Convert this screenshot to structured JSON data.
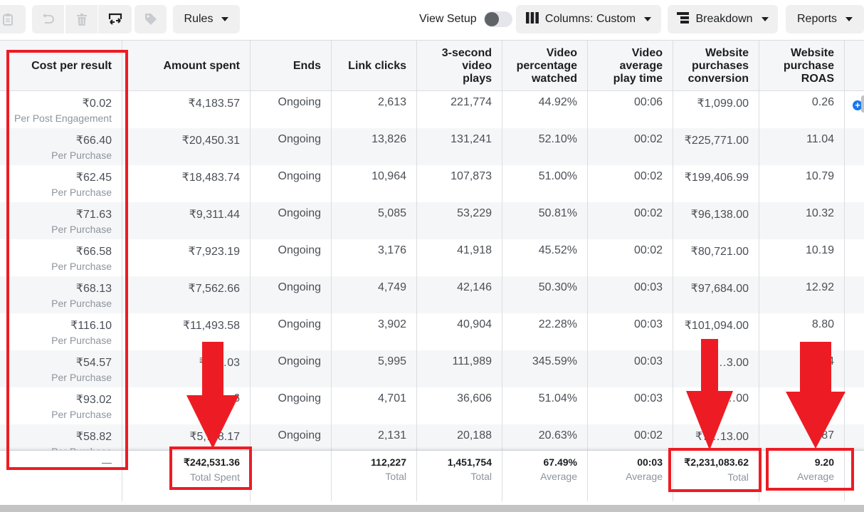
{
  "toolbar": {
    "icons": [
      {
        "name": "clipboard-icon",
        "disabled": true
      },
      {
        "name": "undo-icon",
        "disabled": true
      },
      {
        "name": "trash-icon",
        "disabled": true
      },
      {
        "name": "ab-test-icon",
        "disabled": false
      },
      {
        "name": "tag-icon",
        "disabled": true
      }
    ],
    "rules_label": "Rules",
    "view_setup_label": "View Setup",
    "view_setup_on": false,
    "columns_label": "Columns: Custom",
    "breakdown_label": "Breakdown",
    "reports_label": "Reports"
  },
  "table": {
    "headers": [
      "Cost per result",
      "Amount spent",
      "Ends",
      "Link clicks",
      "3-second video plays",
      "Video percentage watched",
      "Video average play time",
      "Website purchases conversion",
      "Website purchase ROAS"
    ],
    "rows": [
      {
        "cost": "₹0.02",
        "cost_type": "Per Post Engagement",
        "spent": "₹4,183.57",
        "ends": "Ongoing",
        "clicks": "2,613",
        "plays": "221,774",
        "pct": "44.92%",
        "avg_time": "00:06",
        "conv": "₹1,099.00",
        "roas": "0.26"
      },
      {
        "cost": "₹66.40",
        "cost_type": "Per Purchase",
        "spent": "₹20,450.31",
        "ends": "Ongoing",
        "clicks": "13,826",
        "plays": "131,241",
        "pct": "52.10%",
        "avg_time": "00:02",
        "conv": "₹225,771.00",
        "roas": "11.04"
      },
      {
        "cost": "₹62.45",
        "cost_type": "Per Purchase",
        "spent": "₹18,483.74",
        "ends": "Ongoing",
        "clicks": "10,964",
        "plays": "107,873",
        "pct": "51.00%",
        "avg_time": "00:02",
        "conv": "₹199,406.99",
        "roas": "10.79"
      },
      {
        "cost": "₹71.63",
        "cost_type": "Per Purchase",
        "spent": "₹9,311.44",
        "ends": "Ongoing",
        "clicks": "5,085",
        "plays": "53,229",
        "pct": "50.81%",
        "avg_time": "00:02",
        "conv": "₹96,138.00",
        "roas": "10.32"
      },
      {
        "cost": "₹66.58",
        "cost_type": "Per Purchase",
        "spent": "₹7,923.19",
        "ends": "Ongoing",
        "clicks": "3,176",
        "plays": "41,918",
        "pct": "45.52%",
        "avg_time": "00:02",
        "conv": "₹80,721.00",
        "roas": "10.19"
      },
      {
        "cost": "₹68.13",
        "cost_type": "Per Purchase",
        "spent": "₹7,562.66",
        "ends": "Ongoing",
        "clicks": "4,749",
        "plays": "42,146",
        "pct": "50.30%",
        "avg_time": "00:03",
        "conv": "₹97,684.00",
        "roas": "12.92"
      },
      {
        "cost": "₹116.10",
        "cost_type": "Per Purchase",
        "spent": "₹11,493.58",
        "ends": "Ongoing",
        "clicks": "3,902",
        "plays": "40,904",
        "pct": "22.28%",
        "avg_time": "00:03",
        "conv": "₹101,094.00",
        "roas": "8.80"
      },
      {
        "cost": "₹54.57",
        "cost_type": "Per Purchase",
        "spent": "₹5,…03",
        "ends": "Ongoing",
        "clicks": "5,995",
        "plays": "111,989",
        "pct": "345.59%",
        "avg_time": "00:03",
        "conv": "₹9…3.00",
        "roas": "…4"
      },
      {
        "cost": "₹93.02",
        "cost_type": "Per Purchase",
        "spent": "…6",
        "ends": "Ongoing",
        "clicks": "4,701",
        "plays": "36,606",
        "pct": "51.04%",
        "avg_time": "00:03",
        "conv": "…00",
        "roas": ""
      },
      {
        "cost": "₹58.82",
        "cost_type": "Per Purchase",
        "spent": "₹5,…8.17",
        "ends": "Ongoing",
        "clicks": "2,131",
        "plays": "20,188",
        "pct": "20.63%",
        "avg_time": "00:02",
        "conv": "₹7…13.00",
        "roas": "…87"
      }
    ],
    "summary": {
      "cost": "—",
      "spent": "₹242,531.36",
      "spent_label": "Total Spent",
      "ends": "",
      "clicks": "112,227",
      "clicks_label": "Total",
      "plays": "1,451,754",
      "plays_label": "Total",
      "pct": "67.49%",
      "pct_label": "Average",
      "avg_time": "00:03",
      "avg_time_label": "Average",
      "conv": "₹2,231,083.62",
      "conv_label": "Total",
      "roas": "9.20",
      "roas_label": "Average"
    },
    "add_column_icon": "plus-circle-icon"
  },
  "annotation_color": "#ed1c24"
}
